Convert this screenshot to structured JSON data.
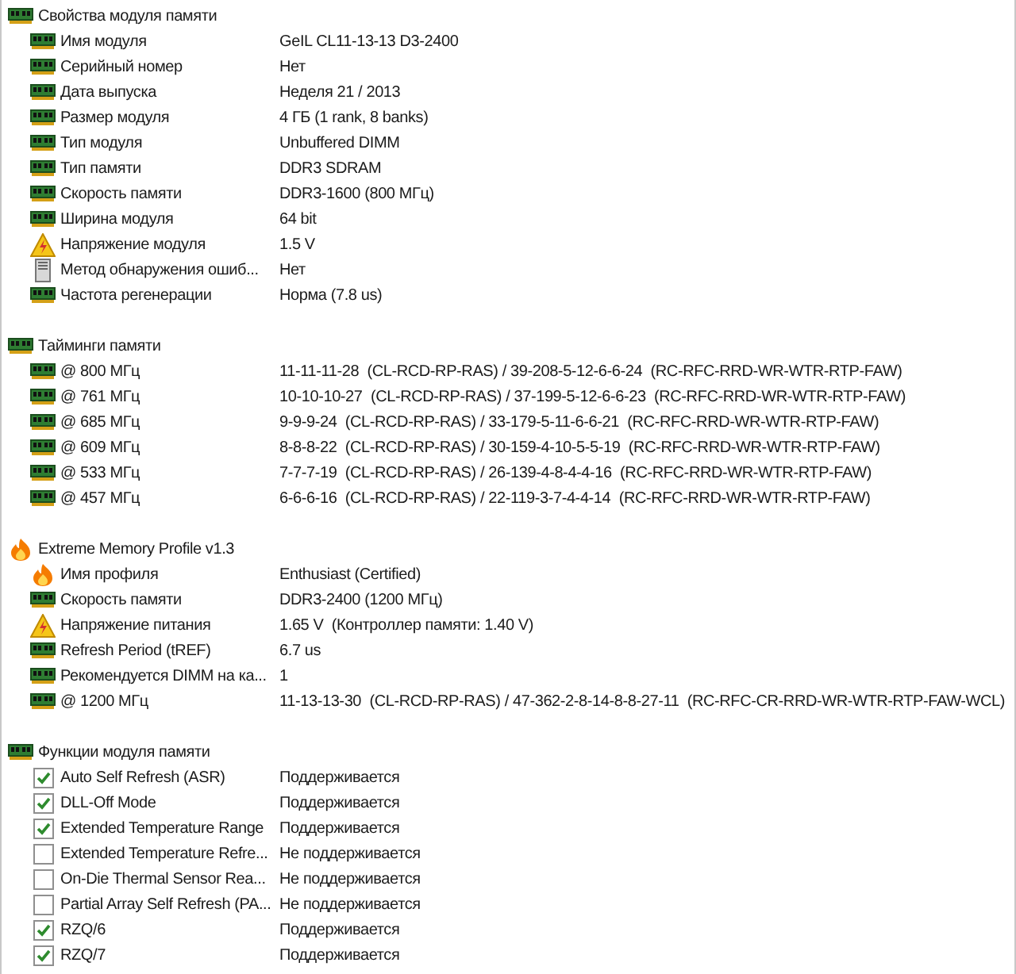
{
  "sections": [
    {
      "title": "Свойства модуля памяти",
      "kind": "ram",
      "items": [
        {
          "kind": "ram",
          "label": "Имя модуля",
          "value": "GeIL CL11-13-13 D3-2400"
        },
        {
          "kind": "ram",
          "label": "Серийный номер",
          "value": "Нет"
        },
        {
          "kind": "ram",
          "label": "Дата выпуска",
          "value": "Неделя 21 / 2013"
        },
        {
          "kind": "ram",
          "label": "Размер модуля",
          "value": "4 ГБ (1 rank, 8 banks)"
        },
        {
          "kind": "ram",
          "label": "Тип модуля",
          "value": "Unbuffered DIMM"
        },
        {
          "kind": "ram",
          "label": "Тип памяти",
          "value": "DDR3 SDRAM"
        },
        {
          "kind": "ram",
          "label": "Скорость памяти",
          "value": "DDR3-1600 (800 МГц)"
        },
        {
          "kind": "ram",
          "label": "Ширина модуля",
          "value": "64 bit"
        },
        {
          "kind": "warning",
          "label": "Напряжение модуля",
          "value": "1.5 V"
        },
        {
          "kind": "tower",
          "label": "Метод обнаружения ошиб...",
          "value": "Нет"
        },
        {
          "kind": "ram",
          "label": "Частота регенерации",
          "value": "Норма (7.8 us)"
        }
      ]
    },
    {
      "title": "Тайминги памяти",
      "kind": "ram",
      "items": [
        {
          "kind": "ram",
          "label": "@ 800 МГц",
          "value": "11-11-11-28  (CL-RCD-RP-RAS) / 39-208-5-12-6-6-24  (RC-RFC-RRD-WR-WTR-RTP-FAW)"
        },
        {
          "kind": "ram",
          "label": "@ 761 МГц",
          "value": "10-10-10-27  (CL-RCD-RP-RAS) / 37-199-5-12-6-6-23  (RC-RFC-RRD-WR-WTR-RTP-FAW)"
        },
        {
          "kind": "ram",
          "label": "@ 685 МГц",
          "value": "9-9-9-24  (CL-RCD-RP-RAS) / 33-179-5-11-6-6-21  (RC-RFC-RRD-WR-WTR-RTP-FAW)"
        },
        {
          "kind": "ram",
          "label": "@ 609 МГц",
          "value": "8-8-8-22  (CL-RCD-RP-RAS) / 30-159-4-10-5-5-19  (RC-RFC-RRD-WR-WTR-RTP-FAW)"
        },
        {
          "kind": "ram",
          "label": "@ 533 МГц",
          "value": "7-7-7-19  (CL-RCD-RP-RAS) / 26-139-4-8-4-4-16  (RC-RFC-RRD-WR-WTR-RTP-FAW)"
        },
        {
          "kind": "ram",
          "label": "@ 457 МГц",
          "value": "6-6-6-16  (CL-RCD-RP-RAS) / 22-119-3-7-4-4-14  (RC-RFC-RRD-WR-WTR-RTP-FAW)"
        }
      ]
    },
    {
      "title": "Extreme Memory Profile v1.3",
      "kind": "flame",
      "items": [
        {
          "kind": "flame",
          "label": "Имя профиля",
          "value": "Enthusiast (Certified)"
        },
        {
          "kind": "ram",
          "label": "Скорость памяти",
          "value": "DDR3-2400 (1200 МГц)"
        },
        {
          "kind": "warning",
          "label": "Напряжение питания",
          "value": "1.65 V  (Контроллер памяти: 1.40 V)"
        },
        {
          "kind": "ram",
          "label": "Refresh Period (tREF)",
          "value": "6.7 us"
        },
        {
          "kind": "ram",
          "label": "Рекомендуется DIMM на ка...",
          "value": "1"
        },
        {
          "kind": "ram",
          "label": "@ 1200 МГц",
          "value": "11-13-13-30  (CL-RCD-RP-RAS) / 47-362-2-8-14-8-8-27-11  (RC-RFC-CR-RRD-WR-WTR-RTP-FAW-WCL)"
        }
      ]
    },
    {
      "title": "Функции модуля памяти",
      "kind": "ram",
      "items": [
        {
          "kind": "checkbox",
          "checked": true,
          "label": "Auto Self Refresh (ASR)",
          "value": "Поддерживается"
        },
        {
          "kind": "checkbox",
          "checked": true,
          "label": "DLL-Off Mode",
          "value": "Поддерживается"
        },
        {
          "kind": "checkbox",
          "checked": true,
          "label": "Extended Temperature Range",
          "value": "Поддерживается"
        },
        {
          "kind": "checkbox",
          "checked": false,
          "label": "Extended Temperature Refre...",
          "value": "Не поддерживается"
        },
        {
          "kind": "checkbox",
          "checked": false,
          "label": "On-Die Thermal Sensor Rea...",
          "value": "Не поддерживается"
        },
        {
          "kind": "checkbox",
          "checked": false,
          "label": "Partial Array Self Refresh (PA...",
          "value": "Не поддерживается"
        },
        {
          "kind": "checkbox",
          "checked": true,
          "label": "RZQ/6",
          "value": "Поддерживается"
        },
        {
          "kind": "checkbox",
          "checked": true,
          "label": "RZQ/7",
          "value": "Поддерживается"
        }
      ]
    }
  ]
}
